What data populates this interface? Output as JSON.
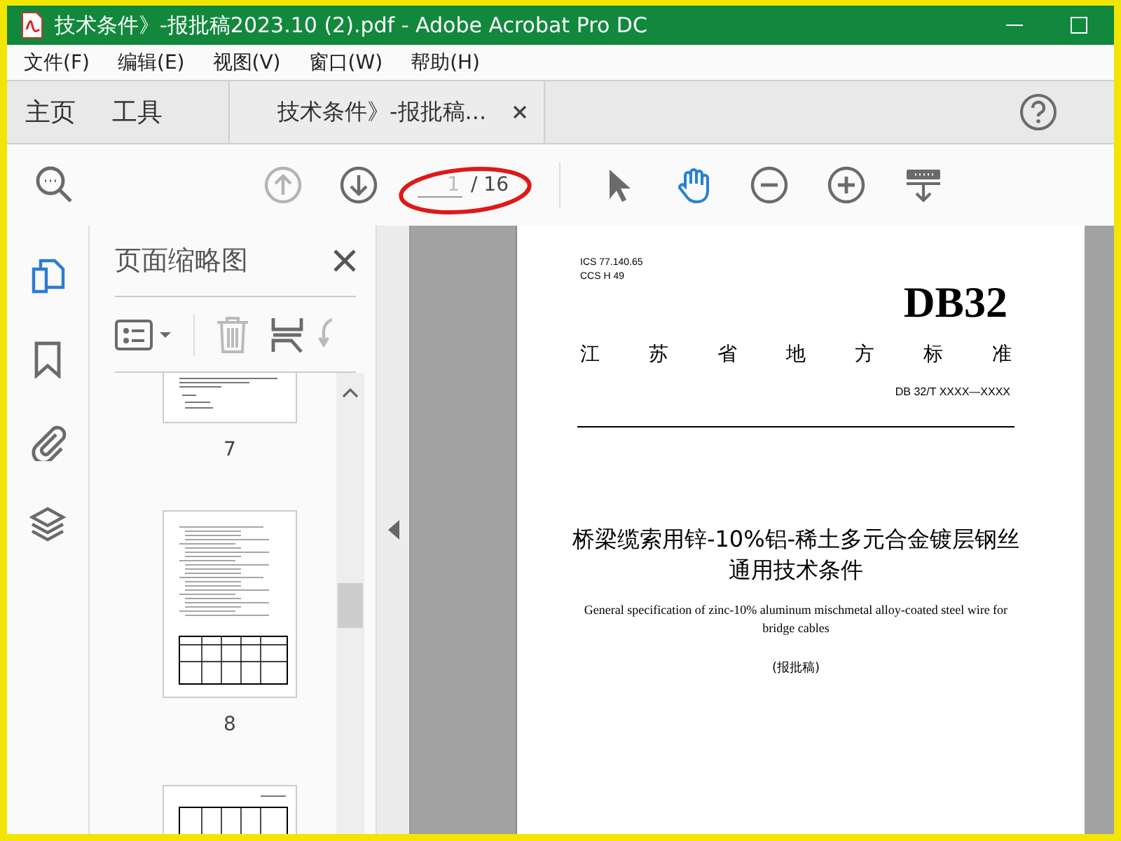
{
  "window": {
    "title": "技术条件》-报批稿2023.10 (2).pdf - Adobe Acrobat Pro DC"
  },
  "menu": [
    "文件(F)",
    "编辑(E)",
    "视图(V)",
    "窗口(W)",
    "帮助(H)"
  ],
  "tabs": [
    {
      "label": "主页",
      "kind": "nav",
      "selected": false
    },
    {
      "label": "工具",
      "kind": "nav",
      "selected": false
    },
    {
      "label": "技术条件》-报批稿...",
      "kind": "document",
      "selected": true
    }
  ],
  "toolbar": {
    "page_number": "1",
    "page_count": "/ 16",
    "page_circled": true,
    "tools": [
      {
        "kind": "prev-page",
        "disabled": true
      },
      {
        "kind": "next-page",
        "disabled": false
      },
      {
        "kind": "select",
        "selected": false
      },
      {
        "kind": "hand",
        "selected": true
      },
      {
        "kind": "zoom-out",
        "selected": false
      },
      {
        "kind": "zoom-in",
        "selected": false
      },
      {
        "kind": "scan",
        "selected": false
      }
    ]
  },
  "side_rail": [
    {
      "kind": "pages",
      "selected": true
    },
    {
      "kind": "bookmarks",
      "selected": false
    },
    {
      "kind": "attachments",
      "selected": false
    },
    {
      "kind": "layers",
      "selected": false
    }
  ],
  "thumbnail_panel": {
    "title": "页面缩略图",
    "delete_disabled": true,
    "pages": [
      {
        "kind": "text",
        "label": "7"
      },
      {
        "kind": "table",
        "label": "8"
      },
      {
        "kind": "table-top"
      }
    ]
  },
  "document": {
    "ics": "ICS  77.140.65",
    "ccs": "CCS H 49",
    "code": "DB32",
    "issuer": "江苏省地方标准",
    "number": "DB 32/T  XXXX—XXXX",
    "title_cn": "桥梁缆索用锌-10%铝-稀土多元合金镀层钢丝通用技术条件",
    "title_en": "General specification of zinc-10% aluminum mischmetal alloy-coated steel wire for bridge cables",
    "stage": "(报批稿)"
  }
}
